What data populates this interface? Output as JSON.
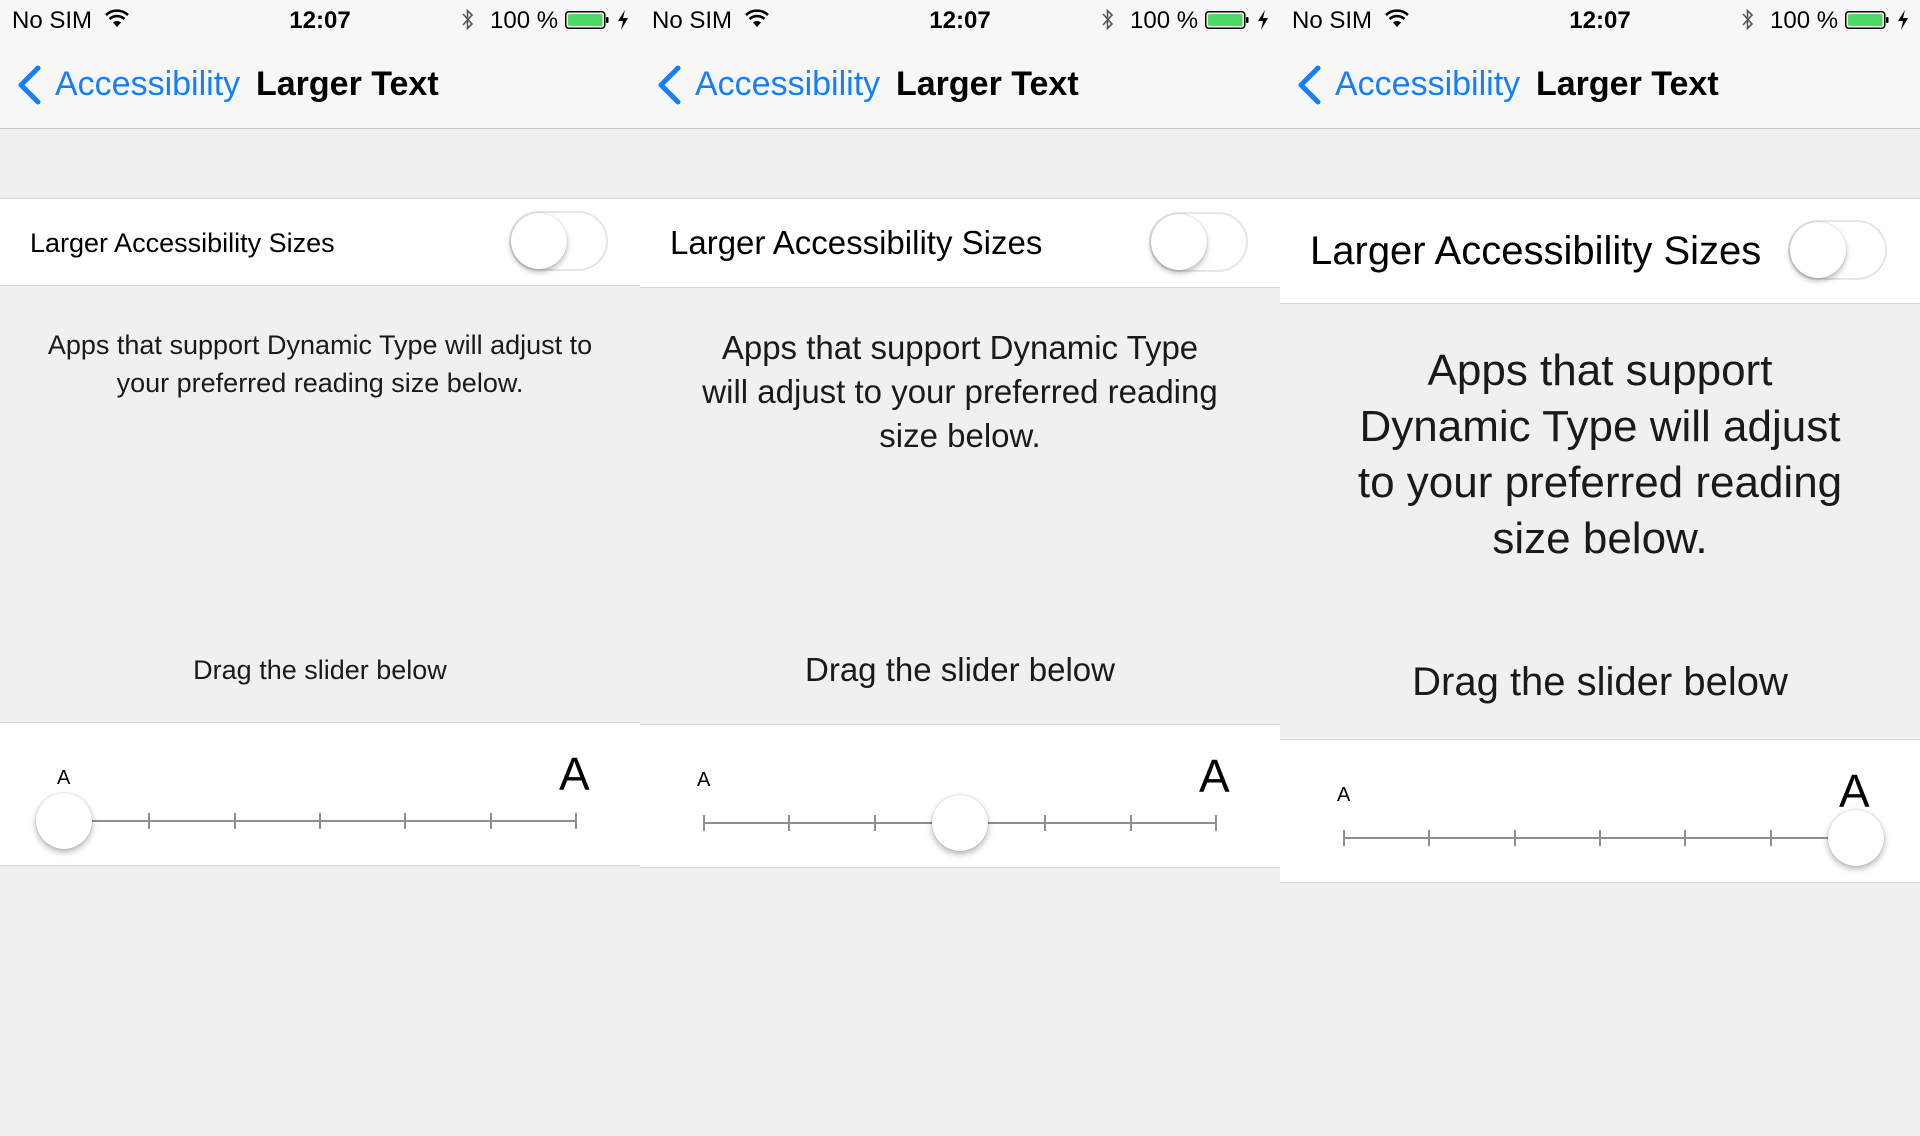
{
  "screens": [
    {
      "status": {
        "carrier": "No SIM",
        "time": "12:07",
        "battery": "100 %"
      },
      "nav": {
        "back_label": "Accessibility",
        "title": "Larger Text"
      },
      "toggle": {
        "label": "Larger Accessibility Sizes",
        "on": false
      },
      "description": "Apps that support Dynamic Type will adjust to your preferred reading size below.",
      "slider_hint": "Drag the slider below",
      "slider": {
        "small_label": "A",
        "large_label": "A",
        "position": 0,
        "steps": 7
      }
    },
    {
      "status": {
        "carrier": "No SIM",
        "time": "12:07",
        "battery": "100 %"
      },
      "nav": {
        "back_label": "Accessibility",
        "title": "Larger Text"
      },
      "toggle": {
        "label": "Larger Accessibility Sizes",
        "on": false
      },
      "description": "Apps that support Dynamic Type will adjust to your preferred reading size below.",
      "slider_hint": "Drag the slider below",
      "slider": {
        "small_label": "A",
        "large_label": "A",
        "position": 3,
        "steps": 7
      }
    },
    {
      "status": {
        "carrier": "No SIM",
        "time": "12:07",
        "battery": "100 %"
      },
      "nav": {
        "back_label": "Accessibility",
        "title": "Larger Text"
      },
      "toggle": {
        "label": "Larger Accessibility Sizes",
        "on": false
      },
      "description": "Apps that support Dynamic Type will adjust to your preferred reading size below.",
      "slider_hint": "Drag the slider below",
      "slider": {
        "small_label": "A",
        "large_label": "A",
        "position": 6,
        "steps": 7
      }
    }
  ],
  "colors": {
    "accent": "#147efb",
    "background": "#efeff4",
    "battery": "#4cd964"
  }
}
